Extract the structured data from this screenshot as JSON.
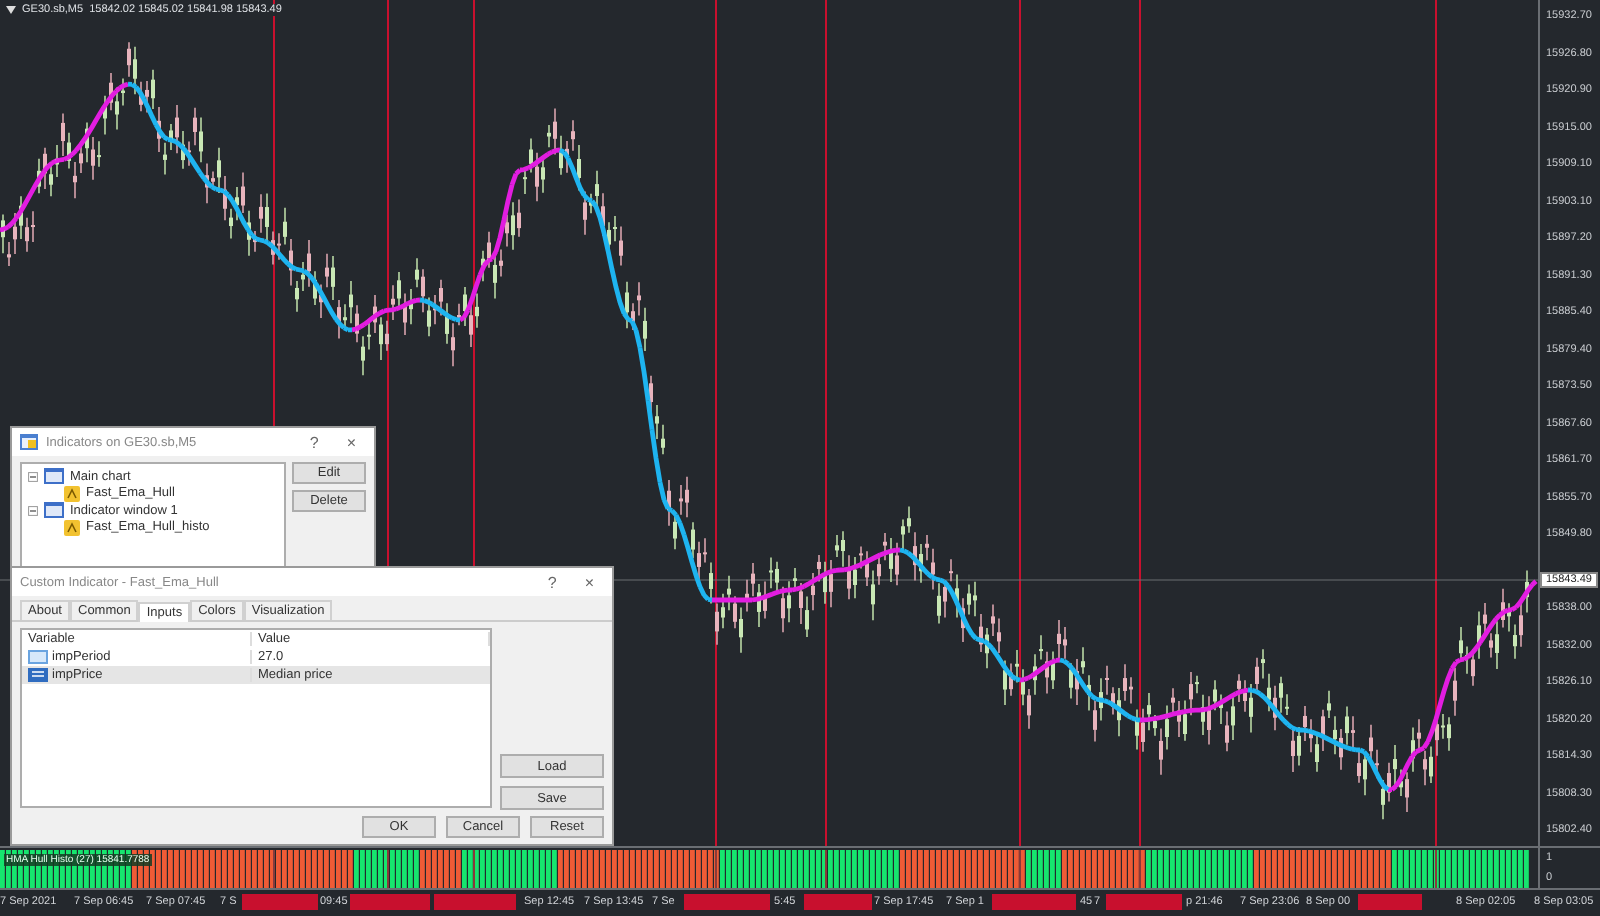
{
  "chart_header": {
    "symbol": "GE30.sb,M5",
    "quote": "15842.02 15845.02 15841.98 15843.49"
  },
  "price_axis": [
    "15932.70",
    "15926.80",
    "15920.90",
    "15915.00",
    "15909.10",
    "15903.10",
    "15897.20",
    "15891.30",
    "15885.40",
    "15879.40",
    "15873.50",
    "15867.60",
    "15861.70",
    "15855.70",
    "15849.80",
    "15838.00",
    "15832.00",
    "15826.10",
    "15820.20",
    "15814.30",
    "15808.30",
    "15802.40"
  ],
  "current_price": "15843.49",
  "subwindow": {
    "label": "HMA Hull Histo (27) 15841.7788",
    "axis": [
      "1",
      "0"
    ]
  },
  "time_axis": [
    {
      "text": "7 Sep 2021",
      "kind": "tick"
    },
    {
      "text": "7 Sep 06:45",
      "kind": "tick"
    },
    {
      "text": "7 Sep 07:45",
      "kind": "tick"
    },
    {
      "text": "7 S",
      "kind": "tick"
    },
    {
      "kind": "marker"
    },
    {
      "text": "09:45",
      "kind": "tick"
    },
    {
      "kind": "marker"
    },
    {
      "kind": "marker"
    },
    {
      "text": "Sep 12:45",
      "kind": "tick"
    },
    {
      "text": "7 Sep 13:45",
      "kind": "tick"
    },
    {
      "text": "7 Se",
      "kind": "tick"
    },
    {
      "kind": "marker"
    },
    {
      "text": "5:45",
      "kind": "tick"
    },
    {
      "kind": "marker"
    },
    {
      "text": "7 Sep 17:45",
      "kind": "tick"
    },
    {
      "text": "7 Sep 1",
      "kind": "tick"
    },
    {
      "kind": "marker"
    },
    {
      "text": "45",
      "kind": "tick"
    },
    {
      "text": "7",
      "kind": "tick"
    },
    {
      "kind": "marker"
    },
    {
      "text": "p 21:46",
      "kind": "tick"
    },
    {
      "text": "7 Sep 23:06",
      "kind": "tick"
    },
    {
      "text": "8 Sep 00",
      "kind": "tick"
    },
    {
      "kind": "marker"
    },
    {
      "text": "8 Sep 02:05",
      "kind": "tick"
    },
    {
      "text": "8 Sep 03:05",
      "kind": "tick"
    }
  ],
  "indicators_dialog": {
    "title": "Indicators on GE30.sb,M5",
    "help": "?",
    "close": "×",
    "tree": [
      {
        "label": "Main chart",
        "expanded": true,
        "children": [
          {
            "label": "Fast_Ema_Hull"
          }
        ]
      },
      {
        "label": "Indicator window 1",
        "expanded": true,
        "children": [
          {
            "label": "Fast_Ema_Hull_histo"
          }
        ]
      }
    ],
    "buttons": [
      "Edit",
      "Delete"
    ]
  },
  "custom_dialog": {
    "title": "Custom Indicator - Fast_Ema_Hull",
    "help": "?",
    "close": "×",
    "tabs": [
      {
        "label": "About",
        "selected": false
      },
      {
        "label": "Common",
        "selected": false
      },
      {
        "label": "Inputs",
        "selected": true
      },
      {
        "label": "Colors",
        "selected": false
      },
      {
        "label": "Visualization",
        "selected": false
      }
    ],
    "columns": [
      "Variable",
      "Value"
    ],
    "rows": [
      {
        "kind": "number",
        "variable": "impPeriod",
        "value": "27.0",
        "selected": false
      },
      {
        "kind": "enum",
        "variable": "impPrice",
        "value": "Median price",
        "selected": true
      }
    ],
    "side_buttons": [
      "Load",
      "Save"
    ],
    "buttons": [
      "OK",
      "Cancel",
      "Reset"
    ]
  }
}
